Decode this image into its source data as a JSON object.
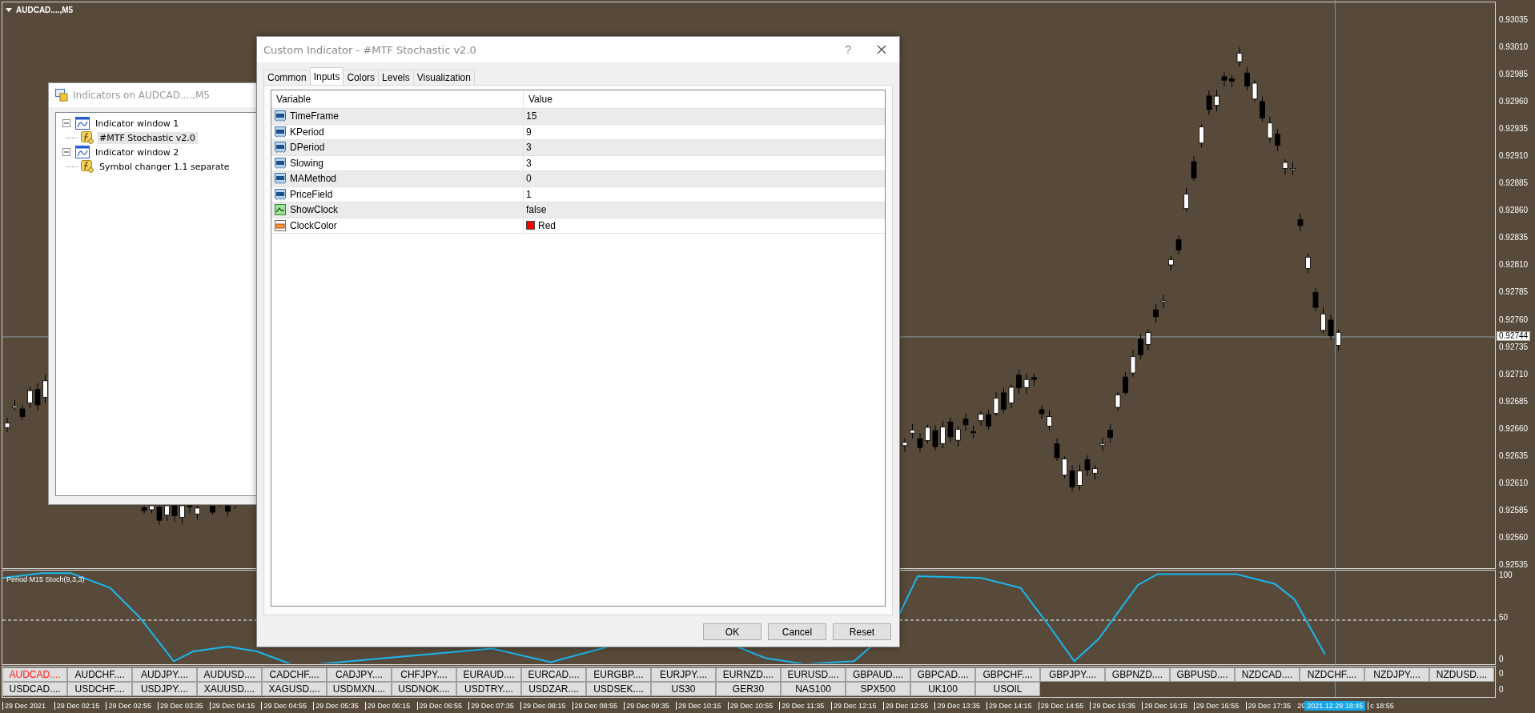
{
  "chart": {
    "title": "AUDCAD....,M5",
    "current_price": "0.92744",
    "price_labels": [
      "0.93035",
      "0.93010",
      "0.92985",
      "0.92960",
      "0.92935",
      "0.92910",
      "0.92885",
      "0.92860",
      "0.92835",
      "0.92810",
      "0.92785",
      "0.92760",
      "0.92735",
      "0.92710",
      "0.92685",
      "0.92660",
      "0.92635",
      "0.92610",
      "0.92585",
      "0.92560",
      "0.92535"
    ]
  },
  "indicator_pane": {
    "label": "Period M15 Stoch(9,3,3)",
    "axis_labels": [
      "100",
      "50",
      "0"
    ]
  },
  "symbol_pane": {
    "axis_labels": [
      "0",
      "0"
    ],
    "rows": [
      [
        {
          "label": "AUDCAD....",
          "selected": true
        },
        {
          "label": "AUDCHF....",
          "selected": false
        },
        {
          "label": "AUDJPY....",
          "selected": false
        },
        {
          "label": "AUDUSD....",
          "selected": false
        },
        {
          "label": "CADCHF....",
          "selected": false
        },
        {
          "label": "CADJPY....",
          "selected": false
        },
        {
          "label": "CHFJPY....",
          "selected": false
        },
        {
          "label": "EURAUD....",
          "selected": false
        },
        {
          "label": "EURCAD....",
          "selected": false
        },
        {
          "label": "EURGBP....",
          "selected": false
        },
        {
          "label": "EURJPY....",
          "selected": false
        },
        {
          "label": "EURNZD....",
          "selected": false
        },
        {
          "label": "EURUSD....",
          "selected": false
        },
        {
          "label": "GBPAUD....",
          "selected": false
        },
        {
          "label": "GBPCAD....",
          "selected": false
        },
        {
          "label": "GBPCHF....",
          "selected": false
        },
        {
          "label": "GBPJPY....",
          "selected": false
        },
        {
          "label": "GBPNZD....",
          "selected": false
        },
        {
          "label": "GBPUSD....",
          "selected": false
        },
        {
          "label": "NZDCAD....",
          "selected": false
        },
        {
          "label": "NZDCHF....",
          "selected": false
        },
        {
          "label": "NZDJPY....",
          "selected": false
        },
        {
          "label": "NZDUSD....",
          "selected": false
        }
      ],
      [
        {
          "label": "USDCAD....",
          "selected": false
        },
        {
          "label": "USDCHF....",
          "selected": false
        },
        {
          "label": "USDJPY....",
          "selected": false
        },
        {
          "label": "XAUUSD....",
          "selected": false
        },
        {
          "label": "XAGUSD....",
          "selected": false
        },
        {
          "label": "USDMXN....",
          "selected": false
        },
        {
          "label": "USDNOK....",
          "selected": false
        },
        {
          "label": "USDTRY....",
          "selected": false
        },
        {
          "label": "USDZAR....",
          "selected": false
        },
        {
          "label": "USDSEK....",
          "selected": false
        },
        {
          "label": "US30",
          "selected": false
        },
        {
          "label": "GER30",
          "selected": false
        },
        {
          "label": "NAS100",
          "selected": false
        },
        {
          "label": "SPX500",
          "selected": false
        },
        {
          "label": "UK100",
          "selected": false
        },
        {
          "label": "USOIL",
          "selected": false
        }
      ]
    ]
  },
  "time_axis": {
    "labels": [
      "29 Dec 2021",
      "29 Dec 02:15",
      "29 Dec 02:55",
      "29 Dec 03:35",
      "29 Dec 04:15",
      "29 Dec 04:55",
      "29 Dec 05:35",
      "29 Dec 06:15",
      "29 Dec 06:55",
      "29 Dec 07:35",
      "29 Dec 08:15",
      "29 Dec 08:55",
      "29 Dec 09:35",
      "29 Dec 10:15",
      "29 Dec 10:55",
      "29 Dec 11:35",
      "29 Dec 12:15",
      "29 Dec 12:55",
      "29 Dec 13:35",
      "29 Dec 14:15",
      "29 Dec 14:55",
      "29 Dec 15:35",
      "29 Dec 16:15",
      "29 Dec 16:55",
      "29 Dec 17:35",
      "29"
    ],
    "cursor_label": "2021.12.29 18:45",
    "trailing_label": "c 18:55"
  },
  "indicators_window": {
    "title": "Indicators on AUDCAD....,M5",
    "tree": [
      {
        "label": "Indicator window 1",
        "expanded": true,
        "children": [
          {
            "label": "#MTF Stochastic v2.0",
            "selected": true
          }
        ]
      },
      {
        "label": "Indicator window 2",
        "expanded": true,
        "children": [
          {
            "label": "Symbol changer 1.1 separate",
            "selected": false
          }
        ]
      }
    ]
  },
  "dialog": {
    "title": "Custom Indicator - #MTF Stochastic v2.0",
    "help": "?",
    "tabs": [
      {
        "label": "Common",
        "selected": false
      },
      {
        "label": "Inputs",
        "selected": true
      },
      {
        "label": "Colors",
        "selected": false
      },
      {
        "label": "Levels",
        "selected": false
      },
      {
        "label": "Visualization",
        "selected": false
      }
    ],
    "table": {
      "columns": [
        "Variable",
        "Value"
      ],
      "rows": [
        {
          "kind": "number",
          "variable": "TimeFrame",
          "value": "15"
        },
        {
          "kind": "number",
          "variable": "KPeriod",
          "value": "9"
        },
        {
          "kind": "number",
          "variable": "DPeriod",
          "value": "3"
        },
        {
          "kind": "number",
          "variable": "Slowing",
          "value": "3"
        },
        {
          "kind": "number",
          "variable": "MAMethod",
          "value": "0"
        },
        {
          "kind": "number",
          "variable": "PriceField",
          "value": "1"
        },
        {
          "kind": "bool",
          "variable": "ShowClock",
          "value": "false"
        },
        {
          "kind": "color",
          "variable": "ClockColor",
          "value": "Red",
          "color": "#ff0000"
        }
      ]
    },
    "buttons": [
      "OK",
      "Cancel",
      "Reset"
    ]
  }
}
